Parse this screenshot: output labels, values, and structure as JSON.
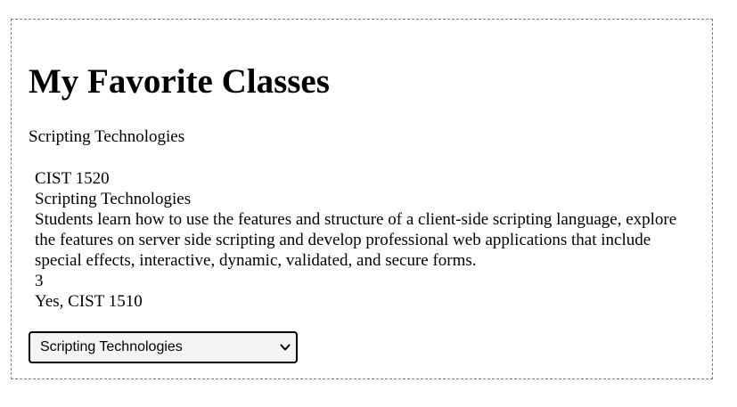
{
  "page": {
    "title": "My Favorite Classes",
    "selected_class_name": "Scripting Technologies"
  },
  "class_details": {
    "code": "CIST 1520",
    "name": "Scripting Technologies",
    "description": "Students learn how to use the features and structure of a client-side scripting language, explore the features on server side scripting and develop professional web applications that include special effects, interactive, dynamic, validated, and secure forms.",
    "credits": "3",
    "prerequisite": "Yes, CIST 1510"
  },
  "class_select": {
    "selected_value": "Scripting Technologies",
    "icon": "chevron-down-icon"
  }
}
